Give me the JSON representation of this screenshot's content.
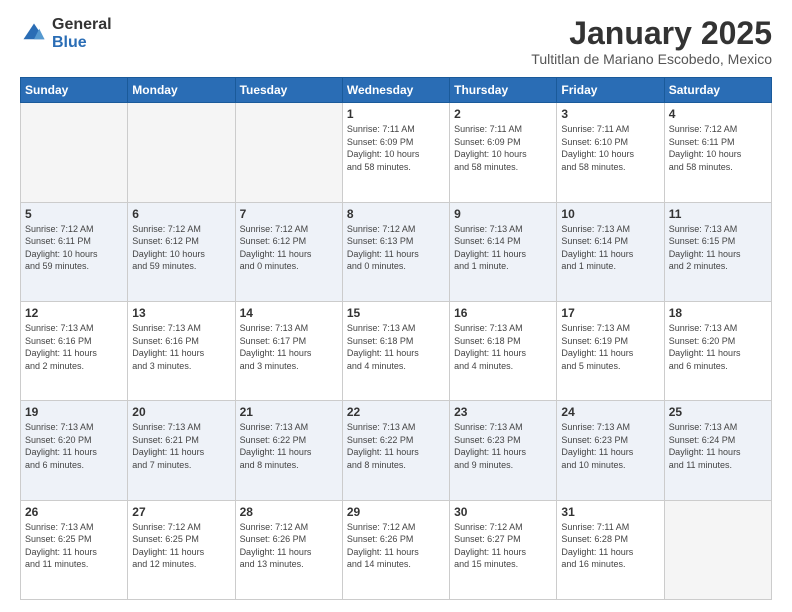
{
  "logo": {
    "general": "General",
    "blue": "Blue"
  },
  "header": {
    "title": "January 2025",
    "subtitle": "Tultitlan de Mariano Escobedo, Mexico"
  },
  "days_of_week": [
    "Sunday",
    "Monday",
    "Tuesday",
    "Wednesday",
    "Thursday",
    "Friday",
    "Saturday"
  ],
  "weeks": [
    [
      {
        "day": "",
        "info": ""
      },
      {
        "day": "",
        "info": ""
      },
      {
        "day": "",
        "info": ""
      },
      {
        "day": "1",
        "info": "Sunrise: 7:11 AM\nSunset: 6:09 PM\nDaylight: 10 hours\nand 58 minutes."
      },
      {
        "day": "2",
        "info": "Sunrise: 7:11 AM\nSunset: 6:09 PM\nDaylight: 10 hours\nand 58 minutes."
      },
      {
        "day": "3",
        "info": "Sunrise: 7:11 AM\nSunset: 6:10 PM\nDaylight: 10 hours\nand 58 minutes."
      },
      {
        "day": "4",
        "info": "Sunrise: 7:12 AM\nSunset: 6:11 PM\nDaylight: 10 hours\nand 58 minutes."
      }
    ],
    [
      {
        "day": "5",
        "info": "Sunrise: 7:12 AM\nSunset: 6:11 PM\nDaylight: 10 hours\nand 59 minutes."
      },
      {
        "day": "6",
        "info": "Sunrise: 7:12 AM\nSunset: 6:12 PM\nDaylight: 10 hours\nand 59 minutes."
      },
      {
        "day": "7",
        "info": "Sunrise: 7:12 AM\nSunset: 6:12 PM\nDaylight: 11 hours\nand 0 minutes."
      },
      {
        "day": "8",
        "info": "Sunrise: 7:12 AM\nSunset: 6:13 PM\nDaylight: 11 hours\nand 0 minutes."
      },
      {
        "day": "9",
        "info": "Sunrise: 7:13 AM\nSunset: 6:14 PM\nDaylight: 11 hours\nand 1 minute."
      },
      {
        "day": "10",
        "info": "Sunrise: 7:13 AM\nSunset: 6:14 PM\nDaylight: 11 hours\nand 1 minute."
      },
      {
        "day": "11",
        "info": "Sunrise: 7:13 AM\nSunset: 6:15 PM\nDaylight: 11 hours\nand 2 minutes."
      }
    ],
    [
      {
        "day": "12",
        "info": "Sunrise: 7:13 AM\nSunset: 6:16 PM\nDaylight: 11 hours\nand 2 minutes."
      },
      {
        "day": "13",
        "info": "Sunrise: 7:13 AM\nSunset: 6:16 PM\nDaylight: 11 hours\nand 3 minutes."
      },
      {
        "day": "14",
        "info": "Sunrise: 7:13 AM\nSunset: 6:17 PM\nDaylight: 11 hours\nand 3 minutes."
      },
      {
        "day": "15",
        "info": "Sunrise: 7:13 AM\nSunset: 6:18 PM\nDaylight: 11 hours\nand 4 minutes."
      },
      {
        "day": "16",
        "info": "Sunrise: 7:13 AM\nSunset: 6:18 PM\nDaylight: 11 hours\nand 4 minutes."
      },
      {
        "day": "17",
        "info": "Sunrise: 7:13 AM\nSunset: 6:19 PM\nDaylight: 11 hours\nand 5 minutes."
      },
      {
        "day": "18",
        "info": "Sunrise: 7:13 AM\nSunset: 6:20 PM\nDaylight: 11 hours\nand 6 minutes."
      }
    ],
    [
      {
        "day": "19",
        "info": "Sunrise: 7:13 AM\nSunset: 6:20 PM\nDaylight: 11 hours\nand 6 minutes."
      },
      {
        "day": "20",
        "info": "Sunrise: 7:13 AM\nSunset: 6:21 PM\nDaylight: 11 hours\nand 7 minutes."
      },
      {
        "day": "21",
        "info": "Sunrise: 7:13 AM\nSunset: 6:22 PM\nDaylight: 11 hours\nand 8 minutes."
      },
      {
        "day": "22",
        "info": "Sunrise: 7:13 AM\nSunset: 6:22 PM\nDaylight: 11 hours\nand 8 minutes."
      },
      {
        "day": "23",
        "info": "Sunrise: 7:13 AM\nSunset: 6:23 PM\nDaylight: 11 hours\nand 9 minutes."
      },
      {
        "day": "24",
        "info": "Sunrise: 7:13 AM\nSunset: 6:23 PM\nDaylight: 11 hours\nand 10 minutes."
      },
      {
        "day": "25",
        "info": "Sunrise: 7:13 AM\nSunset: 6:24 PM\nDaylight: 11 hours\nand 11 minutes."
      }
    ],
    [
      {
        "day": "26",
        "info": "Sunrise: 7:13 AM\nSunset: 6:25 PM\nDaylight: 11 hours\nand 11 minutes."
      },
      {
        "day": "27",
        "info": "Sunrise: 7:12 AM\nSunset: 6:25 PM\nDaylight: 11 hours\nand 12 minutes."
      },
      {
        "day": "28",
        "info": "Sunrise: 7:12 AM\nSunset: 6:26 PM\nDaylight: 11 hours\nand 13 minutes."
      },
      {
        "day": "29",
        "info": "Sunrise: 7:12 AM\nSunset: 6:26 PM\nDaylight: 11 hours\nand 14 minutes."
      },
      {
        "day": "30",
        "info": "Sunrise: 7:12 AM\nSunset: 6:27 PM\nDaylight: 11 hours\nand 15 minutes."
      },
      {
        "day": "31",
        "info": "Sunrise: 7:11 AM\nSunset: 6:28 PM\nDaylight: 11 hours\nand 16 minutes."
      },
      {
        "day": "",
        "info": ""
      }
    ]
  ]
}
